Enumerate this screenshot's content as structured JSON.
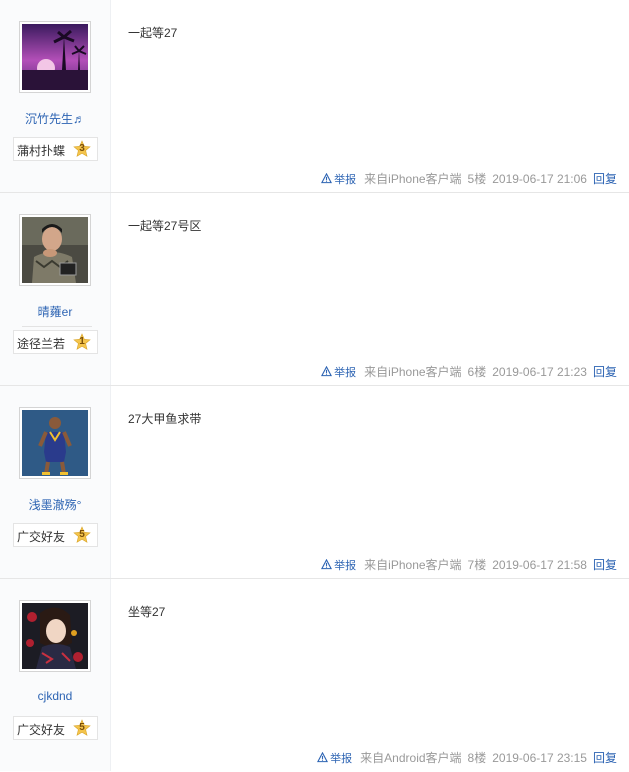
{
  "meta_labels": {
    "report": "举报",
    "reply": "回复"
  },
  "posts": [
    {
      "username": "沉竹先生♬",
      "badge_title": "蒲村扑蝶",
      "badge_level": "3",
      "content": "一起等27",
      "client": "来自iPhone客户端",
      "floor": "5楼",
      "time": "2019-06-17 21:06",
      "avatar_icon": "sunset-palm-avatar"
    },
    {
      "username": "晴蕹er",
      "badge_title": "途径兰若",
      "badge_level": "1",
      "content": "一起等27号区",
      "client": "来自iPhone客户端",
      "floor": "6楼",
      "time": "2019-06-17 21:23",
      "avatar_icon": "man-photo-avatar"
    },
    {
      "username": "浅墨澈殇°",
      "badge_title": "广交好友",
      "badge_level": "5",
      "content": "27大甲鱼求带",
      "client": "来自iPhone客户端",
      "floor": "7楼",
      "time": "2019-06-17 21:58",
      "avatar_icon": "basketball-player-avatar"
    },
    {
      "username": "cjkdnd",
      "badge_title": "广交好友",
      "badge_level": "5",
      "content": "坐等27",
      "client": "来自Android客户端",
      "floor": "8楼",
      "time": "2019-06-17 23:15",
      "avatar_icon": "anime-girl-avatar"
    }
  ],
  "colors": {
    "link": "#2d64b3",
    "meta": "#999999",
    "badge_star": "#f4c44b"
  }
}
